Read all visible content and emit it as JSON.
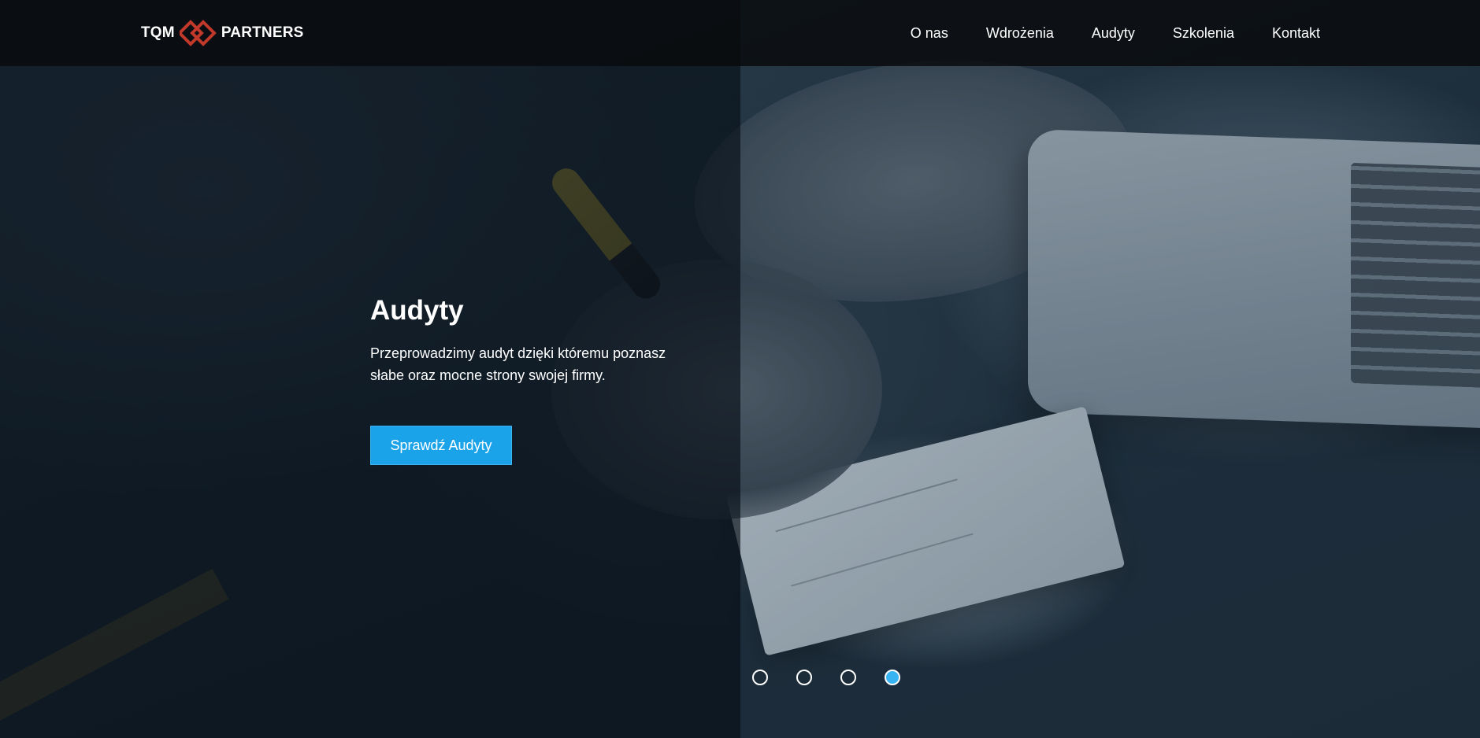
{
  "header": {
    "logo_left": "TQM",
    "logo_right": "PARTNERS",
    "logo_accent": "#c0392b",
    "nav": [
      {
        "label": "O nas"
      },
      {
        "label": "Wdrożenia"
      },
      {
        "label": "Audyty"
      },
      {
        "label": "Szkolenia"
      },
      {
        "label": "Kontakt"
      }
    ]
  },
  "slide": {
    "title": "Audyty",
    "text": "Przeprowadzimy audyt dzięki któremu poznasz słabe oraz mocne strony swojej firmy.",
    "cta_label": "Sprawdź Audyty",
    "cta_color": "#1aa3e8"
  },
  "slider": {
    "total": 4,
    "active_index": 3,
    "active_color": "#39b4f2"
  }
}
